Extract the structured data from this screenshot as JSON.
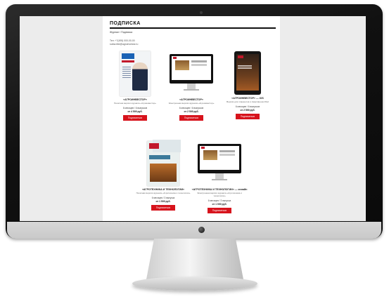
{
  "page": {
    "title": "ПОДПИСКА",
    "breadcrumb": "Журнал / Подписка",
    "info_line1": "Тел: +7(495) 000-00-00",
    "info_line2": "subscribe@agroinvestor.ru"
  },
  "products": [
    {
      "name": "«АГРОИНВЕСТОР»",
      "desc": "Печатная версия журнала «Агроинвестор»",
      "term": "6 месяцев / 6 выпусков",
      "price": "от 4 500 руб.",
      "button": "Подписаться"
    },
    {
      "name": "«АГРОИНВЕСТОР»",
      "desc": "Электронная версия журнала «Агроинвестор»",
      "term": "6 месяцев / 6 выпусков",
      "price": "от 2 500 руб.",
      "button": "Подписаться"
    },
    {
      "name": "«АГРОИНВЕСТОР» — iOS",
      "desc": "Версия для планшетов и смартфонов iPad",
      "term": "6 месяцев / 6 выпусков",
      "price": "от 2 500 руб.",
      "button": "Подписаться"
    },
    {
      "name": "«АГРОТЕХНИКА И ТЕХНОЛОГИИ»",
      "desc": "Печатная версия журнала «Агротехника и технологии»",
      "term": "6 месяцев / 3 выпуска",
      "price": "от 1 500 руб.",
      "button": "Подписаться"
    },
    {
      "name": "«АГРОТЕХНИКА И ТЕХНОЛОГИИ» — онлайн",
      "desc": "Электронная версия журнала «Агротехника и технологии»",
      "term": "6 месяцев / 3 выпуска",
      "price": "от 1 000 руб.",
      "button": "Подписаться"
    }
  ],
  "colors": {
    "accent": "#d7131c",
    "bezel": "#111111"
  }
}
